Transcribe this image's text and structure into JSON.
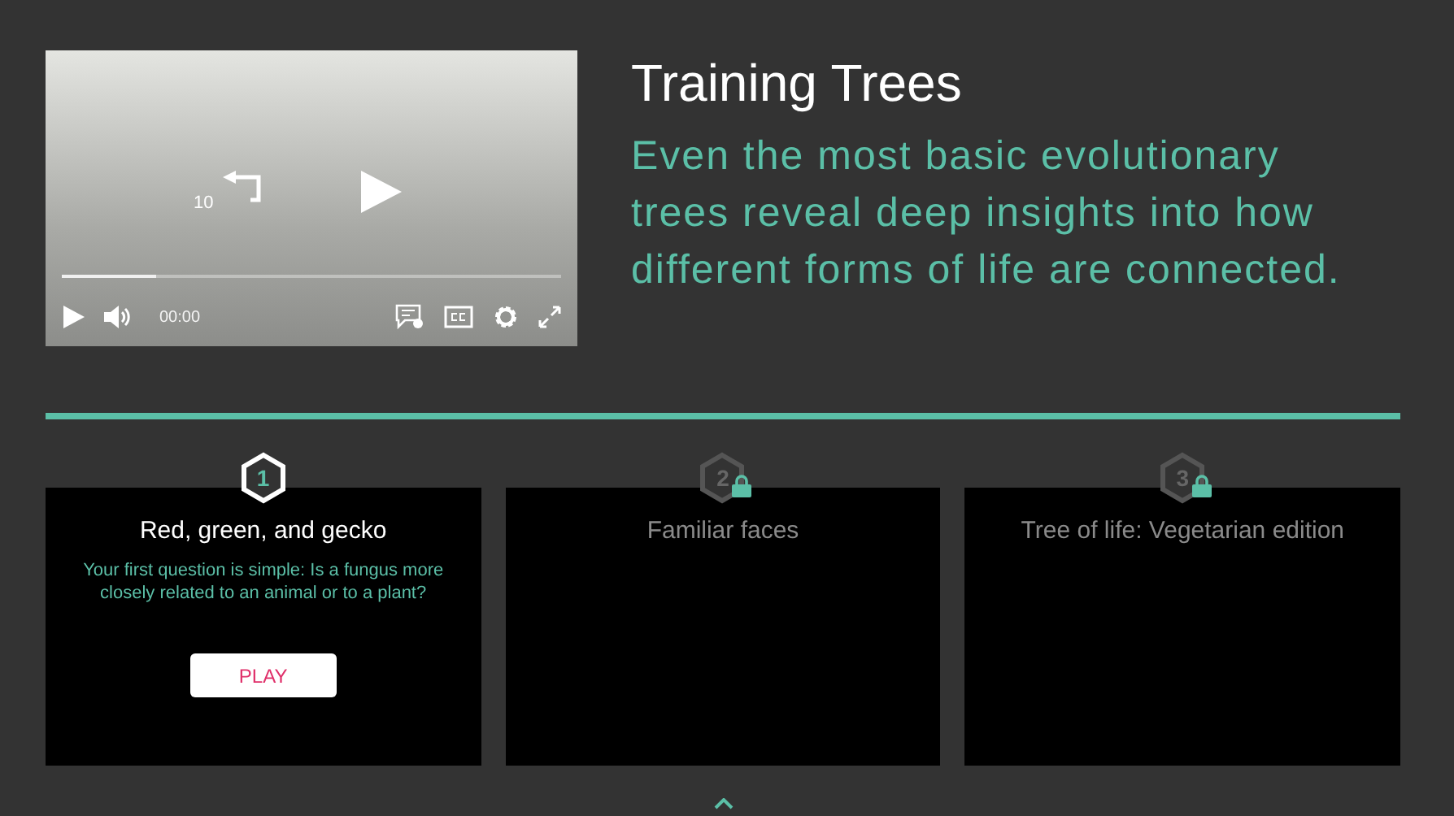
{
  "video": {
    "rewind_label": "10",
    "time": "00:00",
    "progress": {
      "level": 0.19
    }
  },
  "title": "Training Trees",
  "description": "Even the most basic evolutionary trees reveal deep insights into how different forms of life are connected.",
  "levels": [
    {
      "number": "1",
      "title": "Red, green, and gecko",
      "locked": false,
      "description": "Your first question is simple: Is a fungus more closely related to an animal or to a plant?",
      "button": "PLAY"
    },
    {
      "number": "2",
      "title": "Familiar faces",
      "locked": true
    },
    {
      "number": "3",
      "title": "Tree of life: Vegetarian edition",
      "locked": true
    }
  ]
}
